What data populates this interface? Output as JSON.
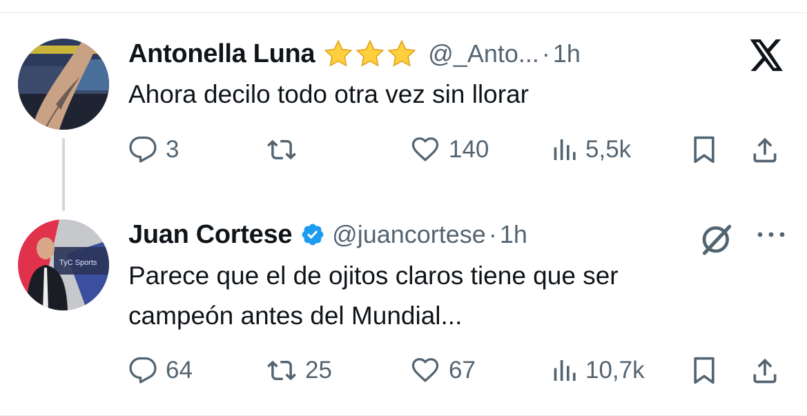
{
  "tweets": [
    {
      "name": "Antonella Luna",
      "name_emoji": "⭐⭐⭐",
      "handle": "@_Anto...",
      "separator": "·",
      "time": "1h",
      "text": "Ahora decilo todo otra vez sin llorar",
      "replies": "3",
      "reposts": "",
      "likes": "140",
      "views": "5,5k"
    },
    {
      "name": "Juan Cortese",
      "verified": true,
      "handle": "@juancortese",
      "separator": "·",
      "time": "1h",
      "text_lines": [
        "Parece que el de ojitos claros tiene que ser",
        "campeón antes del Mundial..."
      ],
      "replies": "64",
      "reposts": "25",
      "likes": "67",
      "views": "10,7k"
    }
  ],
  "avatar_2_text": "TyC Sports",
  "icons": [
    "x-logo-icon",
    "reply-icon",
    "repost-icon",
    "like-icon",
    "views-icon",
    "bookmark-icon",
    "share-icon",
    "verified-icon",
    "grok-icon",
    "more-icon",
    "star-icon"
  ],
  "colors": {
    "text": "#0f1419",
    "secondary": "#536471",
    "verified": "#1d9bf0",
    "divider": "#e6e9ec"
  }
}
